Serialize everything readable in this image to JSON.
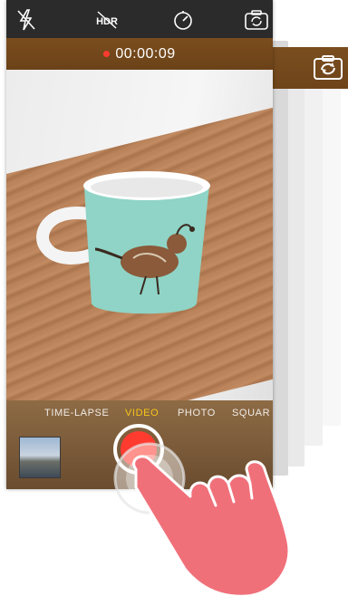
{
  "top_toolbar": {
    "icons": [
      "flash-off-icon",
      "hdr-icon",
      "timer-icon",
      "camera-switch-icon"
    ],
    "hdr_label": "HDR"
  },
  "recording": {
    "timer": "00:00:09",
    "indicator_color": "#ff3b30"
  },
  "modes": {
    "items": [
      "TIME-LAPSE",
      "VIDEO",
      "PHOTO",
      "SQUARE"
    ],
    "visible_text": [
      "TIME-LAPSE",
      "VIDEO",
      "PHOTO",
      "SQUAR"
    ],
    "selected": "VIDEO",
    "selected_color": "#f5c518"
  },
  "shutter": {
    "state": "record",
    "color": "#ff3b30"
  },
  "overlay": {
    "hand_icon": "tap-hand-icon",
    "hand_color": "#f0707a"
  },
  "viewfinder": {
    "subject": "teal mug with quail illustration on wooden table"
  }
}
